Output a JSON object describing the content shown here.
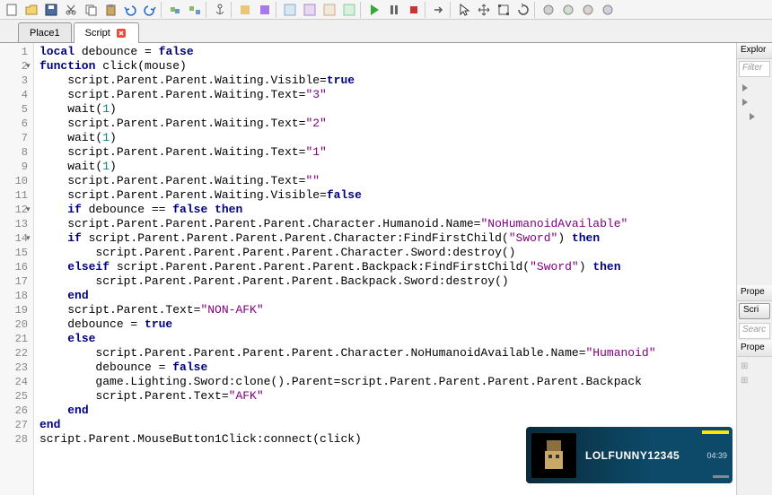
{
  "tabs": [
    {
      "label": "Place1",
      "active": false,
      "closable": false
    },
    {
      "label": "Script",
      "active": true,
      "closable": true
    }
  ],
  "code": {
    "lines": [
      {
        "n": 1,
        "fold": "",
        "tokens": [
          [
            "kw",
            "local"
          ],
          [
            "",
            " debounce = "
          ],
          [
            "bool",
            "false"
          ]
        ]
      },
      {
        "n": 2,
        "fold": "-",
        "tokens": [
          [
            "kw",
            "function"
          ],
          [
            "",
            " click(mouse)"
          ]
        ]
      },
      {
        "n": 3,
        "fold": "",
        "tokens": [
          [
            "",
            "    script.Parent.Parent.Waiting.Visible="
          ],
          [
            "bool",
            "true"
          ]
        ]
      },
      {
        "n": 4,
        "fold": "",
        "tokens": [
          [
            "",
            "    script.Parent.Parent.Waiting.Text="
          ],
          [
            "str",
            "\"3\""
          ]
        ]
      },
      {
        "n": 5,
        "fold": "",
        "tokens": [
          [
            "",
            "    wait("
          ],
          [
            "num",
            "1"
          ],
          [
            "",
            ")"
          ]
        ]
      },
      {
        "n": 6,
        "fold": "",
        "tokens": [
          [
            "",
            "    script.Parent.Parent.Waiting.Text="
          ],
          [
            "str",
            "\"2\""
          ]
        ]
      },
      {
        "n": 7,
        "fold": "",
        "tokens": [
          [
            "",
            "    wait("
          ],
          [
            "num",
            "1"
          ],
          [
            "",
            ")"
          ]
        ]
      },
      {
        "n": 8,
        "fold": "",
        "tokens": [
          [
            "",
            "    script.Parent.Parent.Waiting.Text="
          ],
          [
            "str",
            "\"1\""
          ]
        ]
      },
      {
        "n": 9,
        "fold": "",
        "tokens": [
          [
            "",
            "    wait("
          ],
          [
            "num",
            "1"
          ],
          [
            "",
            ")"
          ]
        ]
      },
      {
        "n": 10,
        "fold": "",
        "tokens": [
          [
            "",
            "    script.Parent.Parent.Waiting.Text="
          ],
          [
            "str",
            "\"\""
          ]
        ]
      },
      {
        "n": 11,
        "fold": "",
        "tokens": [
          [
            "",
            "    script.Parent.Parent.Waiting.Visible="
          ],
          [
            "bool",
            "false"
          ]
        ]
      },
      {
        "n": 12,
        "fold": "-",
        "tokens": [
          [
            "",
            "    "
          ],
          [
            "kw",
            "if"
          ],
          [
            "",
            " debounce == "
          ],
          [
            "bool",
            "false"
          ],
          [
            "",
            " "
          ],
          [
            "kw",
            "then"
          ]
        ]
      },
      {
        "n": 13,
        "fold": "",
        "tokens": [
          [
            "",
            "    script.Parent.Parent.Parent.Parent.Character.Humanoid.Name="
          ],
          [
            "str",
            "\"NoHumanoidAvailable\""
          ]
        ]
      },
      {
        "n": 14,
        "fold": "-",
        "tokens": [
          [
            "",
            "    "
          ],
          [
            "kw",
            "if"
          ],
          [
            "",
            " script.Parent.Parent.Parent.Parent.Character:FindFirstChild("
          ],
          [
            "str",
            "\"Sword\""
          ],
          [
            "",
            ") "
          ],
          [
            "kw",
            "then"
          ]
        ]
      },
      {
        "n": 15,
        "fold": "",
        "tokens": [
          [
            "",
            "        script.Parent.Parent.Parent.Parent.Character.Sword:destroy()"
          ]
        ]
      },
      {
        "n": 16,
        "fold": "",
        "tokens": [
          [
            "",
            "    "
          ],
          [
            "kw",
            "elseif"
          ],
          [
            "",
            " script.Parent.Parent.Parent.Parent.Backpack:FindFirstChild("
          ],
          [
            "str",
            "\"Sword\""
          ],
          [
            "",
            ") "
          ],
          [
            "kw",
            "then"
          ]
        ]
      },
      {
        "n": 17,
        "fold": "",
        "tokens": [
          [
            "",
            "        script.Parent.Parent.Parent.Parent.Backpack.Sword:destroy()"
          ]
        ]
      },
      {
        "n": 18,
        "fold": "",
        "tokens": [
          [
            "",
            "    "
          ],
          [
            "kw",
            "end"
          ]
        ]
      },
      {
        "n": 19,
        "fold": "",
        "tokens": [
          [
            "",
            "    script.Parent.Text="
          ],
          [
            "str",
            "\"NON-AFK\""
          ]
        ]
      },
      {
        "n": 20,
        "fold": "",
        "tokens": [
          [
            "",
            "    debounce = "
          ],
          [
            "bool",
            "true"
          ]
        ]
      },
      {
        "n": 21,
        "fold": "",
        "tokens": [
          [
            "",
            "    "
          ],
          [
            "kw",
            "else"
          ]
        ]
      },
      {
        "n": 22,
        "fold": "",
        "tokens": [
          [
            "",
            "        script.Parent.Parent.Parent.Parent.Character.NoHumanoidAvailable.Name="
          ],
          [
            "str",
            "\"Humanoid\""
          ]
        ]
      },
      {
        "n": 23,
        "fold": "",
        "tokens": [
          [
            "",
            "        debounce = "
          ],
          [
            "bool",
            "false"
          ]
        ]
      },
      {
        "n": 24,
        "fold": "",
        "tokens": [
          [
            "",
            "        game.Lighting.Sword:clone().Parent=script.Parent.Parent.Parent.Parent.Backpack"
          ]
        ]
      },
      {
        "n": 25,
        "fold": "",
        "tokens": [
          [
            "",
            "        script.Parent.Text="
          ],
          [
            "str",
            "\"AFK\""
          ]
        ]
      },
      {
        "n": 26,
        "fold": "",
        "tokens": [
          [
            "",
            "    "
          ],
          [
            "kw",
            "end"
          ]
        ]
      },
      {
        "n": 27,
        "fold": "",
        "tokens": [
          [
            "kw",
            "end"
          ]
        ]
      },
      {
        "n": 28,
        "fold": "",
        "tokens": [
          [
            "",
            "script.Parent.MouseButton1Click:connect(click)"
          ]
        ]
      }
    ]
  },
  "rightpanel": {
    "explorer_title": "Explor",
    "filter_placeholder": "Filter",
    "properties_title": "Prope",
    "script_btn": "Scri",
    "search_placeholder": "Searc",
    "properties_title2": "Prope"
  },
  "notification": {
    "username": "LOLFUNNY12345",
    "time": "04:39"
  },
  "toolbar_icons": [
    "new",
    "open",
    "save",
    "cut",
    "copy",
    "paste",
    "undo",
    "redo",
    "sep",
    "group",
    "ungroup",
    "sep",
    "anchor",
    "sep",
    "color1",
    "color2",
    "sep",
    "grid1",
    "grid2",
    "grid3",
    "grid4",
    "sep",
    "play",
    "pause",
    "stop",
    "sep",
    "arrow",
    "sep",
    "cursor",
    "move",
    "scale",
    "rotate",
    "sep",
    "t1",
    "t2",
    "t3",
    "t4"
  ]
}
